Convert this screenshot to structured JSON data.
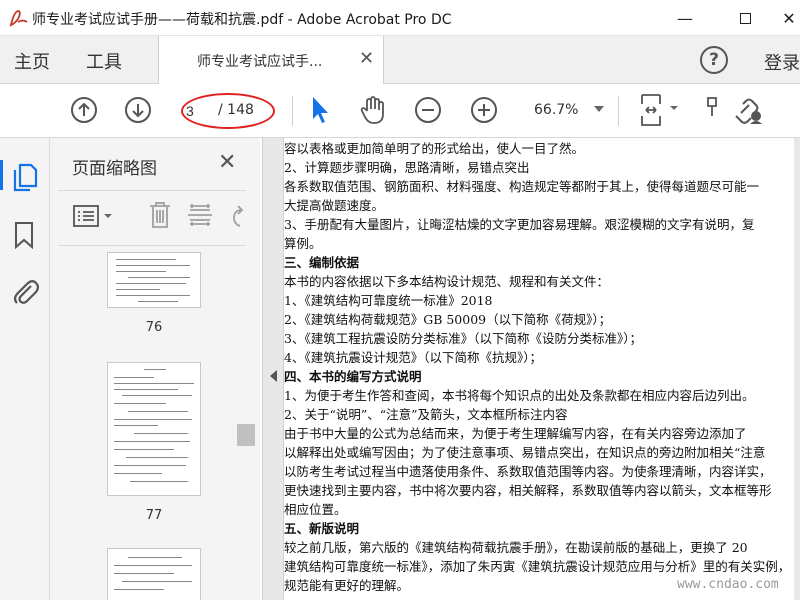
{
  "window": {
    "title": "师专业考试应试手册——荷载和抗震.pdf - Adobe Acrobat Pro DC",
    "minimize": "—",
    "close": "✕"
  },
  "menu": {
    "home": "主页",
    "tools": "工具",
    "doc_tab": "师专业考试应试手...",
    "doc_tab_close": "✕",
    "help": "?",
    "login": "登录"
  },
  "toolbar": {
    "current_page": "3",
    "total_pages": "/ 148",
    "zoom": "66.7%"
  },
  "sidebar": {
    "title": "页面缩略图",
    "close": "✕",
    "thumbnails": [
      {
        "page": "76"
      },
      {
        "page": "77"
      }
    ]
  },
  "document": {
    "lines": [
      {
        "text": "容以表格或更加简单明了的形式给出，使人一目了然。",
        "heading": false
      },
      {
        "text": "    2、计算题步骤明确，思路清晰，易错点突出",
        "heading": false
      },
      {
        "text": "    各系数取值范围、钢筋面积、材料强度、构造规定等都附于其上，使得每道题尽可能一",
        "heading": false
      },
      {
        "text": "大提高做题速度。",
        "heading": false
      },
      {
        "text": "    3、手册配有大量图片，让晦涩枯燥的文字更加容易理解。艰涩模糊的文字有说明，复",
        "heading": false
      },
      {
        "text": "算例。",
        "heading": false
      },
      {
        "text": "    三、编制依据",
        "heading": true
      },
      {
        "text": "    本书的内容依据以下多本结构设计规范、规程和有关文件：",
        "heading": false
      },
      {
        "text": "1、《建筑结构可靠度统一标准》2018",
        "heading": false
      },
      {
        "text": "2、《建筑结构荷载规范》GB 50009（以下简称《荷规》）；",
        "heading": false
      },
      {
        "text": "3、《建筑工程抗震设防分类标准》（以下简称《设防分类标准》）；",
        "heading": false
      },
      {
        "text": "4、《建筑抗震设计规范》（以下简称《抗规》）；",
        "heading": false
      },
      {
        "text": "    四、本书的编写方式说明",
        "heading": true
      },
      {
        "text": "    1、为便于考生作答和查阅，本书将每个知识点的出处及条款都在相应内容后边列出。",
        "heading": false
      },
      {
        "text": "    2、关于“说明”、“注意”及箭头，文本框所标注内容",
        "heading": false
      },
      {
        "text": "    由于书中大量的公式为总结而来，为便于考生理解编写内容，在有关内容旁边添加了",
        "heading": false
      },
      {
        "text": "以解释出处或编写因由；为了使注意事项、易错点突出，在知识点的旁边附加相关“注意",
        "heading": false
      },
      {
        "text": "以防考生考试过程当中遗落使用条件、系数取值范围等内容。为使条理清晰，内容详实，",
        "heading": false
      },
      {
        "text": "更快速找到主要内容，书中将次要内容，相关解释，系数取值等内容以箭头，文本框等形",
        "heading": false
      },
      {
        "text": "相应位置。",
        "heading": false
      },
      {
        "text": "    五、新版说明",
        "heading": true
      },
      {
        "text": "    较之前几版，第六版的《建筑结构荷载抗震手册》，在勘误前版的基础上，更换了 20",
        "heading": false
      },
      {
        "text": "建筑结构可靠度统一标准》，添加了朱丙寅《建筑抗震设计规范应用与分析》里的有关实例，",
        "heading": false
      },
      {
        "text": "规范能有更好的理解。",
        "heading": false
      }
    ]
  },
  "watermark": "www.cndao.com",
  "colors": {
    "accent": "#1473e6",
    "annotation_red": "#e02020",
    "pane_bg": "#f4f4f4"
  },
  "icons": [
    "app-logo-icon",
    "up-arrow-icon",
    "down-arrow-icon",
    "cursor-icon",
    "hand-icon",
    "zoom-out-icon",
    "zoom-in-icon",
    "fit-page-icon",
    "link-icon",
    "cloud-user-icon",
    "thumbnails-icon",
    "bookmark-icon",
    "attachment-icon",
    "options-icon",
    "delete-icon",
    "crop-icon",
    "rotate-icon"
  ]
}
